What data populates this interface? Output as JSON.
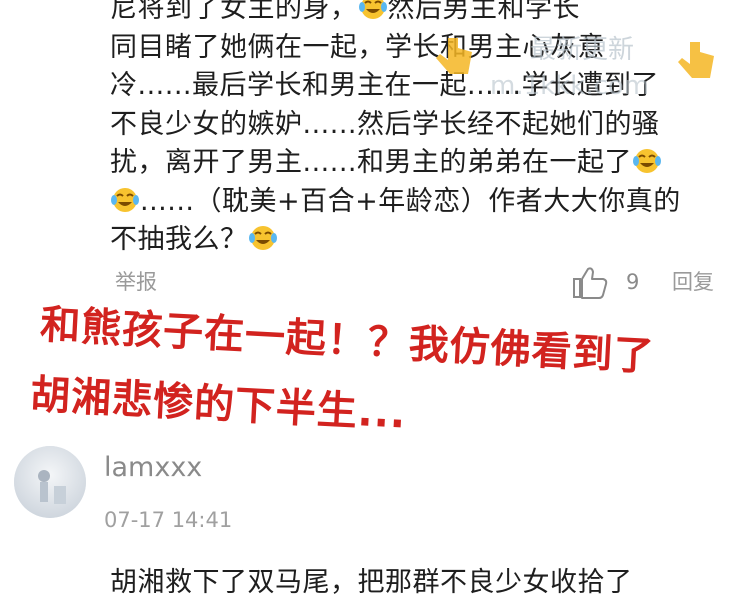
{
  "comment": {
    "lines": [
      "尼将到了女主的身，",
      "同目睹了她俩在一起，学长和男主心灰意",
      "冷......最后学长和男主在一起......学长遭到了",
      "不良少女的嫉妒......然后学长经不起她们的骚",
      "扰，离开了男主......和男主的弟弟在一起了",
      "......（耽美+百合+年龄恋）作者大大你真的",
      "不抽我么？"
    ],
    "line0_tail": "然后男主和学长",
    "emoji_name": "laughing-crying-emoji"
  },
  "watermark": {
    "text1": "最新更新",
    "text2": "m.1kkk.com"
  },
  "actions": {
    "report": "举报",
    "like_count": "9",
    "reply": "回复"
  },
  "overlay": {
    "line1": "和熊孩子在一起！？我仿佛看到了",
    "line2": "胡湘悲惨的下半生...",
    "color": "#d2231f"
  },
  "reply_comment": {
    "username": "lamxxx",
    "timestamp": "07-17 14:41",
    "text": "胡湘救下了双马尾，把那群不良少女收拾了"
  }
}
